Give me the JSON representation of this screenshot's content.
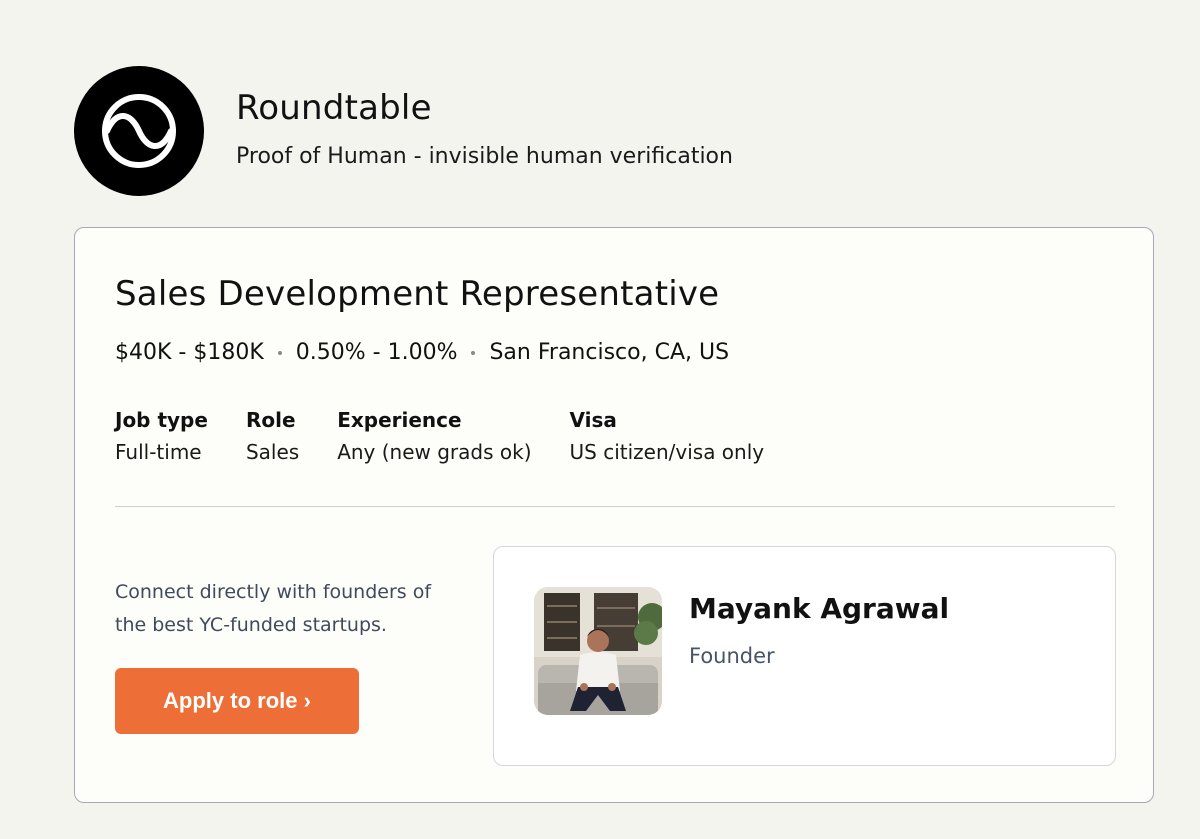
{
  "company": {
    "name": "Roundtable",
    "tagline": "Proof of Human - invisible human verification"
  },
  "job": {
    "title": "Sales Development Representative",
    "salary": "$40K - $180K",
    "equity": "0.50% - 1.00%",
    "location": "San Francisco, CA, US",
    "attributes": [
      {
        "label": "Job type",
        "value": "Full-time"
      },
      {
        "label": "Role",
        "value": "Sales"
      },
      {
        "label": "Experience",
        "value": "Any (new grads ok)"
      },
      {
        "label": "Visa",
        "value": "US citizen/visa only"
      }
    ]
  },
  "cta": {
    "text": "Connect directly with founders of the best YC-funded startups.",
    "apply_label": "Apply to role ›"
  },
  "founder": {
    "name": "Mayank Agrawal",
    "role": "Founder"
  },
  "colors": {
    "background": "#f4f4ef",
    "accent": "#ed6f37",
    "card_border": "#a8a8b8"
  },
  "icons": {
    "logo": "wave-circle-logo-icon"
  }
}
